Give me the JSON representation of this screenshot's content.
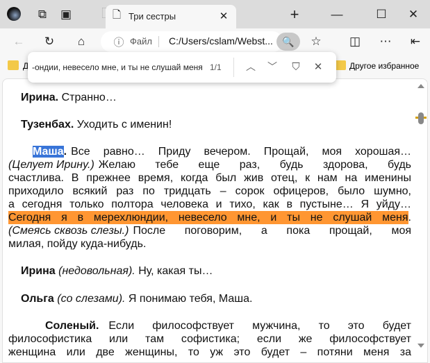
{
  "browser": {
    "tab_title": "Три сестры",
    "address_prefix": "Файл",
    "address": "C:/Users/cslam/Webst...",
    "bookmark_left": "ДЕ",
    "bookmark_other": "Другое избранное"
  },
  "find": {
    "query": "-ондии, невесело мне, и ты не слушай меня",
    "count": "1/1"
  },
  "colors": {
    "highlight_current": "#ff9632",
    "selection": "#3874d8"
  },
  "text": {
    "p1_name": "Ирина.",
    "p1_text": "Странно…",
    "p2_name": "Тузенбах.",
    "p2_text": "Уходить с именин!",
    "p3_name": "Маша",
    "p3_l1": "Все равно… Приду вечером. Прощай, моя хорошая…",
    "p3_l2_it": "(Целует Ирину.)",
    "p3_l2": "Желаю тебе еще раз, будь здорова, будь",
    "p3_l3": "счастлива. В прежнее время, когда был жив отец, к нам на именины",
    "p3_l4": "приходило всякий раз по тридцать – сорок офицеров, было шумно,",
    "p3_l5": "а сегодня только полтора человека и тихо, как в пустыне… Я уйду…",
    "p3_l6_hl": "Сегодня я в мерехлюндии, невесело мне, и ты не слушай меня",
    "p3_l7_it": "(Смеясь сквозь слезы.)",
    "p3_l7": "После поговорим, а пока прощай, моя",
    "p3_l8": "милая, пойду куда-нибудь.",
    "p4_name": "Ирина",
    "p4_it": "(недовольная).",
    "p4_text": "Ну, какая ты…",
    "p5_name": "Ольга",
    "p5_it": "(со слезами).",
    "p5_text": "Я понимаю тебя, Маша.",
    "p6_name": "Соленый.",
    "p6_l1": "Если философствует мужчина, то это будет",
    "p6_l2": "философистика или там софистика; если же философствует",
    "p6_l3": "женщина или две женщины, то уж это будет – потяни меня за"
  }
}
